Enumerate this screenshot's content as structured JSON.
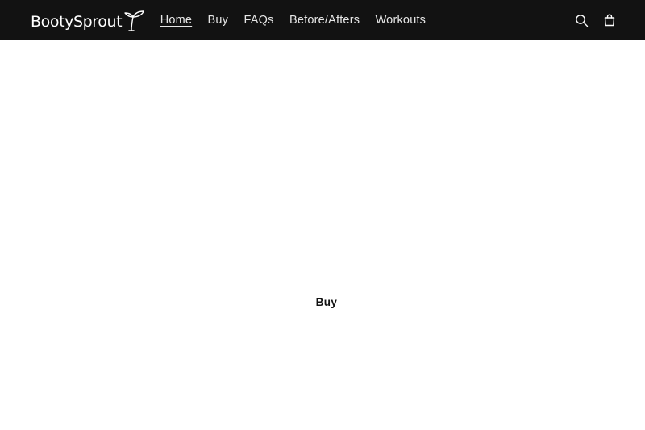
{
  "header": {
    "logo_text": "BootySprout",
    "nav": [
      {
        "label": "Home",
        "active": true
      },
      {
        "label": "Buy",
        "active": false
      },
      {
        "label": "FAQs",
        "active": false
      },
      {
        "label": "Before/Afters",
        "active": false
      },
      {
        "label": "Workouts",
        "active": false
      }
    ],
    "icons": [
      "search-icon",
      "cart-icon"
    ]
  },
  "main": {
    "buy_label": "Buy"
  },
  "colors": {
    "header_bg": "#121212",
    "nav_text": "#e6e6e6",
    "page_bg": "#ffffff",
    "body_text": "#121212"
  }
}
